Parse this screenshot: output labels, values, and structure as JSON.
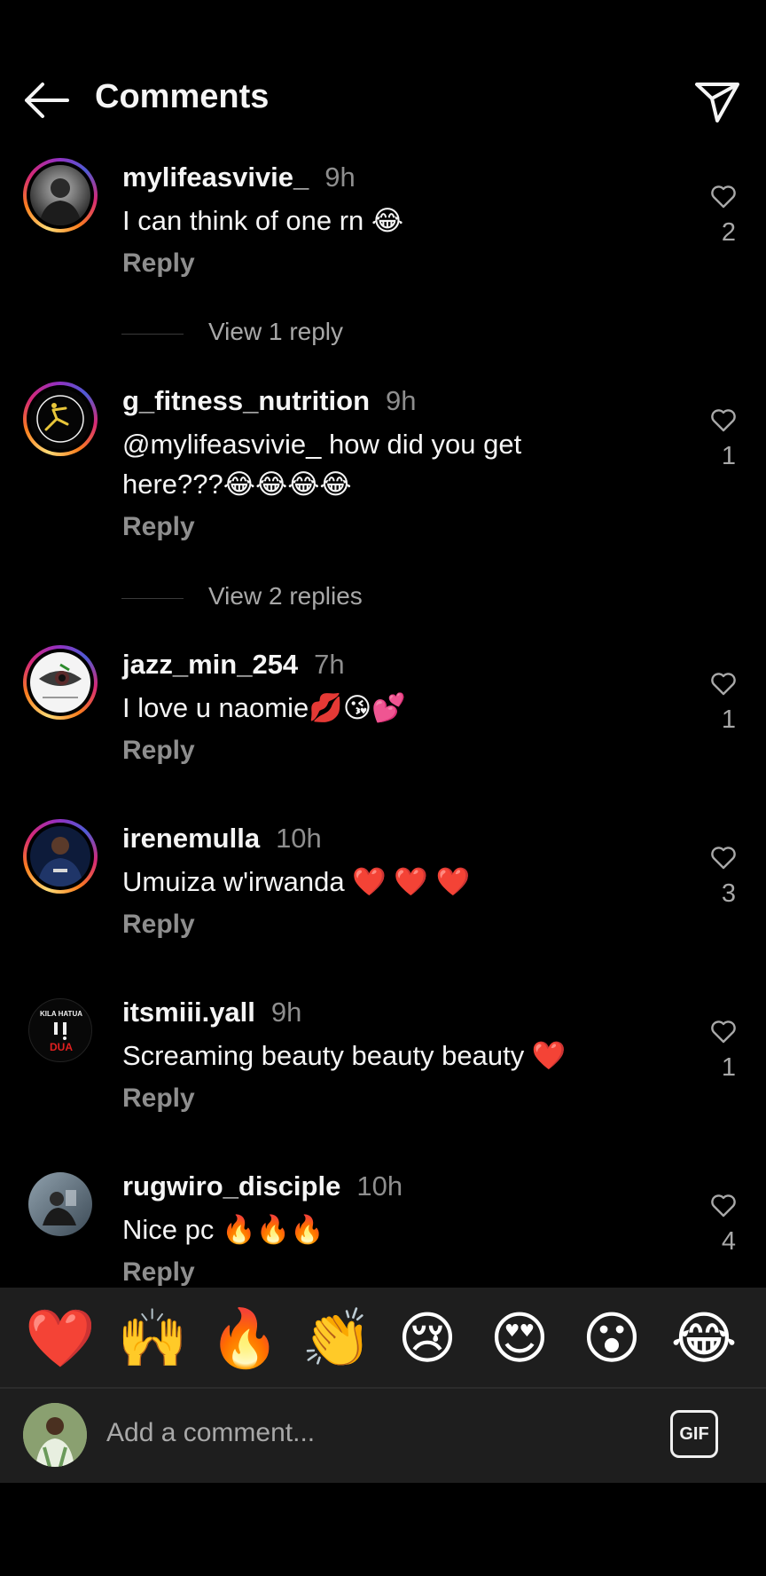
{
  "header": {
    "title": "Comments",
    "back_icon": "arrow-left-icon",
    "send_icon": "paper-plane-icon"
  },
  "comments": [
    {
      "username": "mylifeasvivie_",
      "time": "9h",
      "text": "I can think of one rn 😂",
      "reply": "Reply",
      "likes": "2",
      "view_replies": "View 1 reply"
    },
    {
      "username": "g_fitness_nutrition",
      "time": "9h",
      "text": "@mylifeasvivie_ how did you get here???😂😂😂😂",
      "reply": "Reply",
      "likes": "1",
      "view_replies": "View 2 replies"
    },
    {
      "username": "jazz_min_254",
      "time": "7h",
      "text": "I love u naomie💋😘💕",
      "reply": "Reply",
      "likes": "1"
    },
    {
      "username": "irenemulla",
      "time": "10h",
      "text": "Umuiza w'irwanda ❤️ ❤️ ❤️",
      "reply": "Reply",
      "likes": "3"
    },
    {
      "username": "itsmiii.yall",
      "time": "9h",
      "text": "Screaming beauty beauty beauty ❤️",
      "reply": "Reply",
      "likes": "1",
      "avatar_text": "KILA HATUA",
      "avatar_text2": "DUA"
    },
    {
      "username": "rugwiro_disciple",
      "time": "10h",
      "text": "Nice pc 🔥🔥🔥",
      "reply": "Reply",
      "likes": "4"
    }
  ],
  "emoji_bar": [
    "❤️",
    "🙌",
    "🔥",
    "👏",
    "😢",
    "😍",
    "😮",
    "😂"
  ],
  "composer": {
    "placeholder": "Add a comment...",
    "gif_label": "GIF"
  },
  "colors": {
    "background": "#000000",
    "muted": "#8e8e8e",
    "bar": "#1e1e1e"
  }
}
